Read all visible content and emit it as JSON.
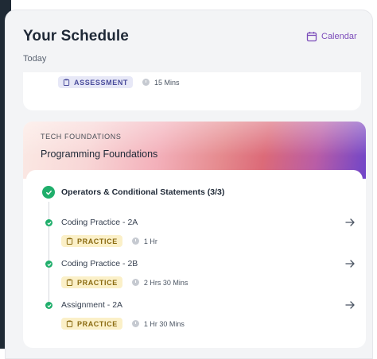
{
  "header": {
    "title": "Your Schedule",
    "subtitle": "Today",
    "calendar_label": "Calendar"
  },
  "top_item": {
    "badge": "ASSESSMENT",
    "duration": "15 Mins"
  },
  "course": {
    "eyebrow": "TECH FOUNDATIONS",
    "title": "Programming Foundations",
    "module_title": "Operators & Conditional Statements (3/3)",
    "items": [
      {
        "title": "Coding Practice - 2A",
        "badge": "PRACTICE",
        "duration": "1 Hr"
      },
      {
        "title": "Coding Practice - 2B",
        "badge": "PRACTICE",
        "duration": "2 Hrs 30 Mins"
      },
      {
        "title": "Assignment - 2A",
        "badge": "PRACTICE",
        "duration": "1 Hr 30 Mins"
      }
    ]
  },
  "colors": {
    "accent": "#7c4dba",
    "success": "#1fae6b",
    "assessment_badge_bg": "#e7e8f7",
    "practice_badge_bg": "#fbf0c8"
  },
  "icons": [
    "calendar-icon",
    "clipboard-icon",
    "clock-icon",
    "check-circle-icon",
    "arrow-right-icon"
  ]
}
